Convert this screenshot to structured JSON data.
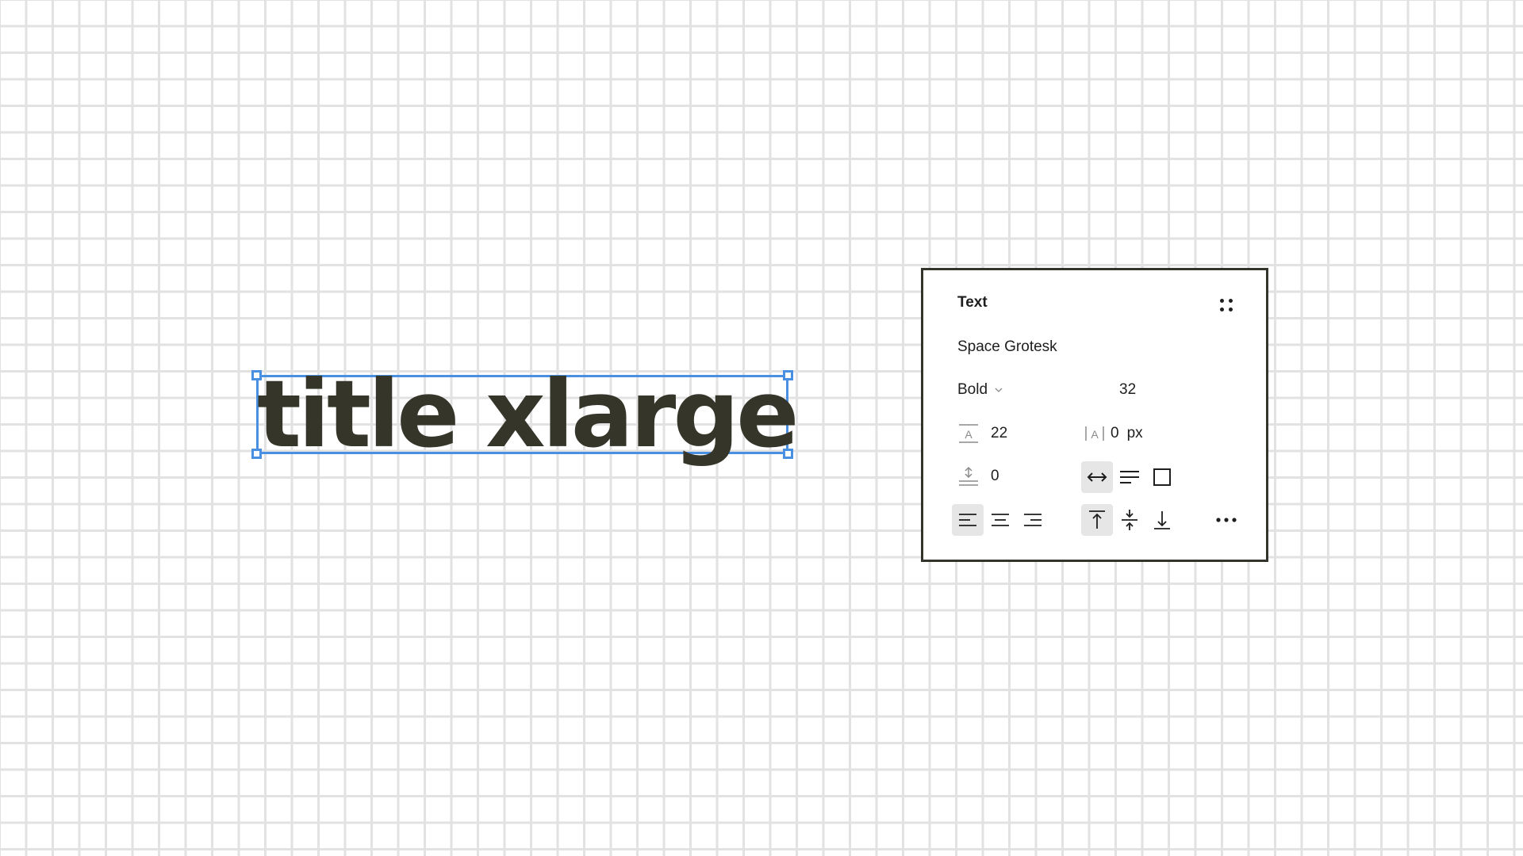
{
  "canvas": {
    "text_object": {
      "content": "title xlarge"
    }
  },
  "panel": {
    "title": "Text",
    "font_family": "Space Grotesk",
    "font_weight": "Bold",
    "font_size": "32",
    "line_height": "22",
    "letter_spacing": "0",
    "letter_spacing_unit": "px",
    "paragraph_spacing": "0",
    "resizing": {
      "auto_width": "active",
      "auto_height": "inactive",
      "fixed": "inactive"
    },
    "horizontal_align": {
      "left": "active",
      "center": "inactive",
      "right": "inactive"
    },
    "vertical_align": {
      "top": "active",
      "middle": "inactive",
      "bottom": "inactive"
    },
    "colors": {
      "selection": "#4a90e2",
      "text": "#36352a",
      "panel_border": "#34352a",
      "active_button": "#e6e6e6"
    }
  }
}
